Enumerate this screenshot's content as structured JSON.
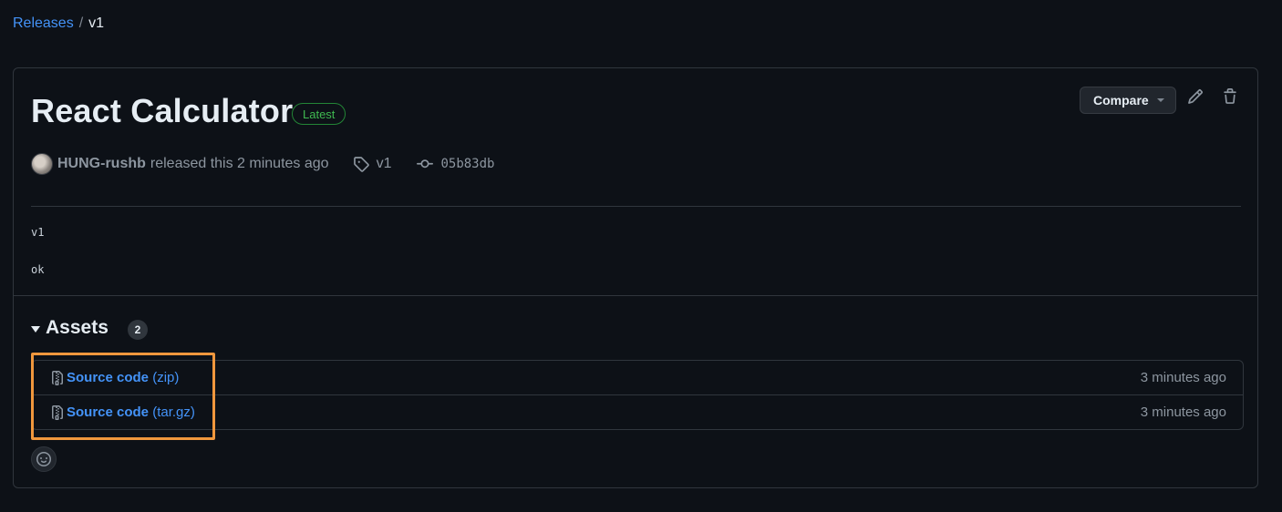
{
  "breadcrumb": {
    "releases": "Releases",
    "separator": "/",
    "current": "v1"
  },
  "release": {
    "title": "React Calculator",
    "latest_badge": "Latest",
    "author": "HUNG-rushb",
    "released_text": "released this 2 minutes ago",
    "tag": "v1",
    "commit": "05b83db",
    "body_lines": [
      "v1",
      "ok"
    ]
  },
  "actions": {
    "compare_label": "Compare",
    "edit_icon": "pencil-icon",
    "delete_icon": "trash-icon"
  },
  "assets": {
    "heading": "Assets",
    "count": "2",
    "items": [
      {
        "name": "Source code",
        "ext": "(zip)",
        "time": "3 minutes ago",
        "icon": "file-zip-icon"
      },
      {
        "name": "Source code",
        "ext": "(tar.gz)",
        "time": "3 minutes ago",
        "icon": "file-zip-icon"
      }
    ]
  },
  "colors": {
    "background": "#0d1117",
    "link": "#4493f8",
    "latest_green": "#3fb950",
    "highlight": "#f0973d",
    "border": "#30363d"
  }
}
